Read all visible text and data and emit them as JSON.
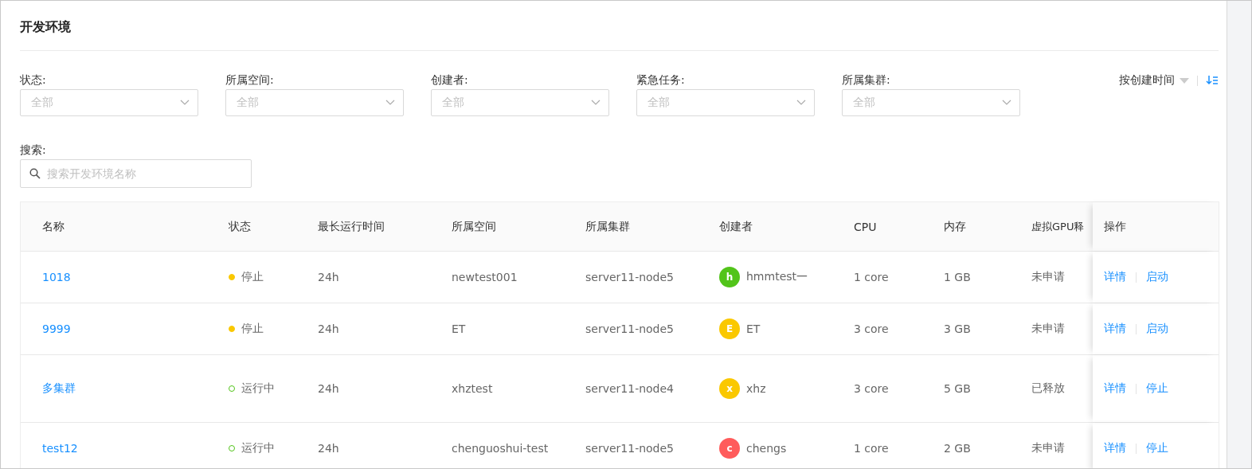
{
  "title": "开发环境",
  "filters": [
    {
      "label": "状态:",
      "placeholder": "全部"
    },
    {
      "label": "所属空间:",
      "placeholder": "全部"
    },
    {
      "label": "创建者:",
      "placeholder": "全部"
    },
    {
      "label": "紧急任务:",
      "placeholder": "全部"
    },
    {
      "label": "所属集群:",
      "placeholder": "全部"
    }
  ],
  "sort": {
    "label": "按创建时间"
  },
  "search": {
    "label": "搜索:",
    "placeholder": "搜索开发环境名称"
  },
  "table": {
    "columns": [
      "名称",
      "状态",
      "最长运行时间",
      "所属空间",
      "所属集群",
      "创建者",
      "CPU",
      "内存",
      "虚拟GPU释",
      "操作"
    ],
    "rows": [
      {
        "name": "1018",
        "status": {
          "kind": "stopped",
          "text": "停止"
        },
        "max_runtime": "24h",
        "space": "newtest001",
        "cluster": "server11-node5",
        "creator": {
          "initial": "h",
          "name": "hmmtest一",
          "color": "#52c41a"
        },
        "cpu": "1 core",
        "memory": "1 GB",
        "vgpu": "未申请",
        "actions": [
          "详情",
          "启动"
        ]
      },
      {
        "name": "9999",
        "status": {
          "kind": "stopped",
          "text": "停止"
        },
        "max_runtime": "24h",
        "space": "ET",
        "cluster": "server11-node5",
        "creator": {
          "initial": "E",
          "name": "ET",
          "color": "#fac800"
        },
        "cpu": "3 core",
        "memory": "3 GB",
        "vgpu": "未申请",
        "actions": [
          "详情",
          "启动"
        ]
      },
      {
        "name": "多集群",
        "status": {
          "kind": "running",
          "text": "运行中"
        },
        "max_runtime": "24h",
        "space": "xhztest",
        "cluster": "server11-node4",
        "creator": {
          "initial": "x",
          "name": "xhz",
          "color": "#fac800"
        },
        "cpu": "3 core",
        "memory": "5 GB",
        "vgpu": "已释放",
        "actions": [
          "详情",
          "停止"
        ]
      },
      {
        "name": "test12",
        "status": {
          "kind": "running",
          "text": "运行中"
        },
        "max_runtime": "24h",
        "space": "chenguoshui-test",
        "cluster": "server11-node5",
        "creator": {
          "initial": "c",
          "name": "chengs",
          "color": "#ff5b5b"
        },
        "cpu": "1 core",
        "memory": "2 GB",
        "vgpu": "未申请",
        "actions": [
          "详情",
          "停止"
        ]
      }
    ]
  }
}
